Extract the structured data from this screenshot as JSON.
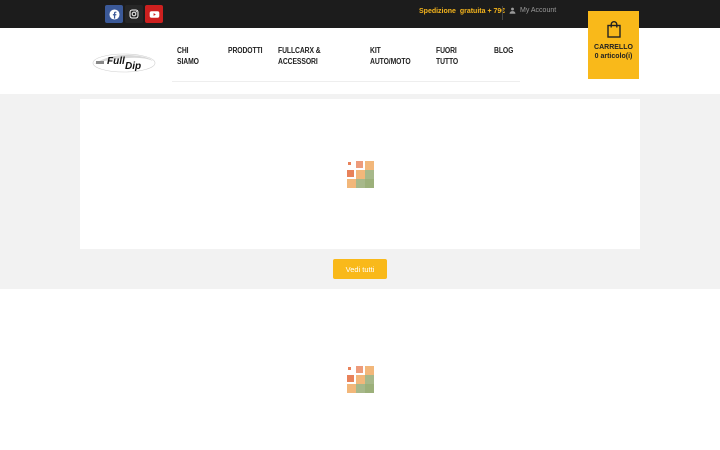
{
  "topbar": {
    "social": [
      "facebook-icon",
      "instagram-icon",
      "youtube-icon"
    ],
    "shipping_text": "Spedizione  gratuita + 79€",
    "account_label": "My Account"
  },
  "header": {
    "logo_text": "Full Dip",
    "nav": [
      {
        "label": "CHI\nSIAMO"
      },
      {
        "label": "PRODOTTI"
      },
      {
        "label": "FULLCARX &\nACCESSORI"
      },
      {
        "label": "KIT\nAUTO/MOTO"
      },
      {
        "label": "FUORI\nTUTTO"
      },
      {
        "label": "BLOG"
      }
    ],
    "cart": {
      "label": "CARRELLO",
      "count": "0 articolo(i)"
    }
  },
  "section1": {
    "button_label": "Vedi tutti"
  },
  "colors": {
    "accent": "#f9b91a",
    "topbar_bg": "#1c1c1c",
    "loader": [
      "#e8825a",
      "#f2b77a",
      "#a7b88a",
      "#9cb07a"
    ]
  }
}
